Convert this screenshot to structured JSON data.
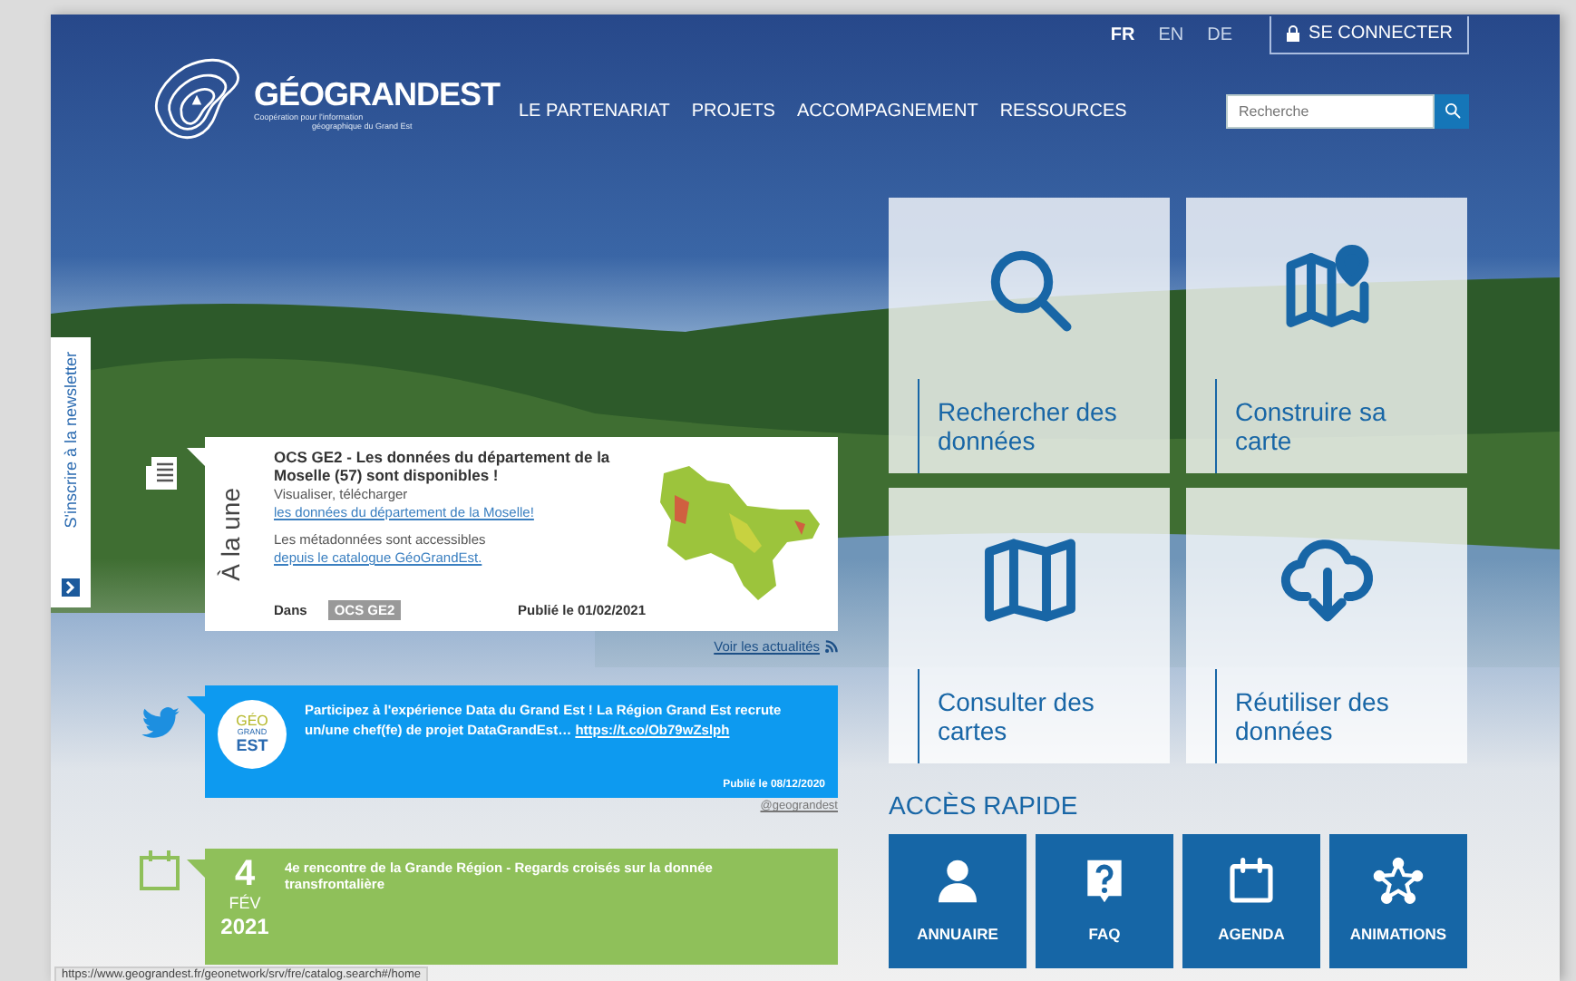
{
  "header": {
    "languages": [
      {
        "label": "FR",
        "selected": true
      },
      {
        "label": "EN",
        "selected": false
      },
      {
        "label": "DE",
        "selected": false
      }
    ],
    "login": "SE CONNECTER",
    "logo": {
      "name": "GÉOGRANDEST",
      "tagline_1": "Coopération pour l'information",
      "tagline_2": "géographique du Grand Est"
    },
    "nav": [
      "LE PARTENARIAT",
      "PROJETS",
      "ACCOMPAGNEMENT",
      "RESSOURCES"
    ],
    "search": {
      "placeholder": "Recherche"
    }
  },
  "newsletter": "S'inscrire à la newsletter",
  "featured": {
    "label": "À la une",
    "title": "OCS GE2 - Les données du département de la Moselle (57) sont disponibles !",
    "paragraphs": [
      {
        "text": "Visualiser, télécharger ",
        "link": "les données du département de la Moselle!"
      },
      {
        "text": "Les métadonnées sont accessibles ",
        "link": "depuis le catalogue GéoGrandEst."
      }
    ],
    "category_label": "Dans",
    "tag": "OCS GE2",
    "date": "Publié le 01/02/2021",
    "more_link": "Voir les actualités"
  },
  "tweet": {
    "avatar": [
      "GÉO",
      "GRAND",
      "EST"
    ],
    "text": "Participez à l'expérience Data du Grand Est ! La Région Grand Est recrute un/une chef(fe) de projet DataGrandEst… ",
    "link": "https://t.co/Ob79wZslph",
    "date": "Publié le 08/12/2020",
    "handle": "@geograndest"
  },
  "event": {
    "day": "4",
    "month": "FÉV",
    "year": "2021",
    "title": "4e rencontre de la Grande Région - Regards croisés sur la donnée transfrontalière"
  },
  "tiles": [
    {
      "kind": "search",
      "label": "Rechercher des données"
    },
    {
      "kind": "map-pin",
      "label": "Construire sa carte"
    },
    {
      "kind": "map",
      "label": "Consulter des cartes"
    },
    {
      "kind": "cloud-download",
      "label": "Réutiliser des données"
    }
  ],
  "quick_access": {
    "title": "ACCÈS RAPIDE",
    "items": [
      {
        "kind": "person",
        "label": "ANNUAIRE"
      },
      {
        "kind": "question",
        "label": "FAQ"
      },
      {
        "kind": "calendar",
        "label": "AGENDA"
      },
      {
        "kind": "star",
        "label": "ANIMATIONS"
      }
    ]
  },
  "status_url": "https://www.geograndest.fr/geonetwork/srv/fre/catalog.search#/home"
}
